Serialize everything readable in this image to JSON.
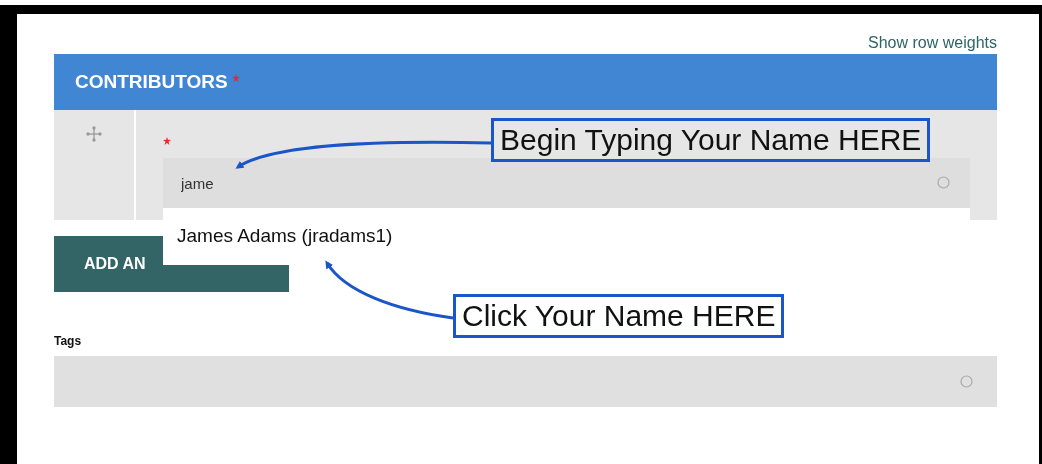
{
  "link": "Show row weights",
  "section": {
    "title": "CONTRIBUTORS",
    "required": true
  },
  "item": {
    "required": true,
    "input_value": "jame"
  },
  "suggestions": [
    {
      "label": "James Adams (jradams1)"
    }
  ],
  "add_button": "ADD AN",
  "tags": {
    "label": "Tags"
  },
  "annotations": [
    {
      "text": "Begin Typing Your Name HERE",
      "kind": "top"
    },
    {
      "text": "Click Your Name HERE",
      "kind": "bottom"
    }
  ]
}
